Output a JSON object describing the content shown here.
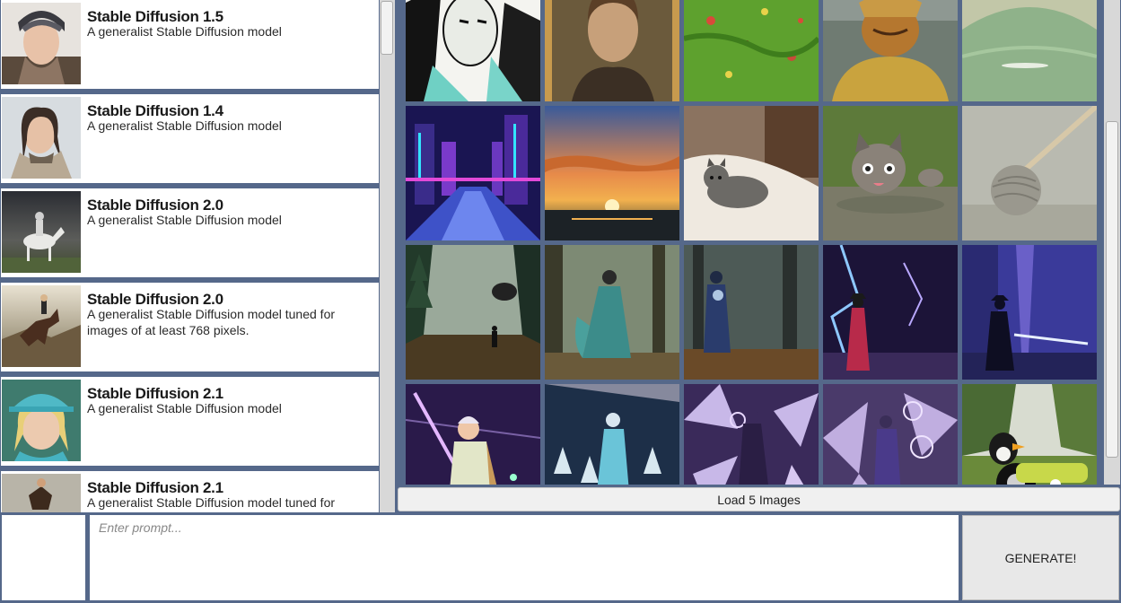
{
  "models": [
    {
      "title": "Stable Diffusion 1.5",
      "description": "A generalist Stable Diffusion model"
    },
    {
      "title": "Stable Diffusion 1.4",
      "description": "A generalist Stable Diffusion model"
    },
    {
      "title": "Stable Diffusion 2.0",
      "description": "A generalist Stable Diffusion model"
    },
    {
      "title": "Stable Diffusion 2.0",
      "description": "A generalist Stable Diffusion model tuned for images of at least 768 pixels."
    },
    {
      "title": "Stable Diffusion 2.1",
      "description": "A generalist Stable Diffusion model"
    },
    {
      "title": "Stable Diffusion 2.1",
      "description": "A generalist Stable Diffusion model tuned for"
    }
  ],
  "gallery": {
    "load_button": "Load 5 Images"
  },
  "prompt": {
    "placeholder": "Enter prompt...",
    "value": ""
  },
  "generate_button": "GENERATE!",
  "colors": {
    "background": "#55688a",
    "panel": "#ffffff",
    "button": "#f0f0f0"
  }
}
